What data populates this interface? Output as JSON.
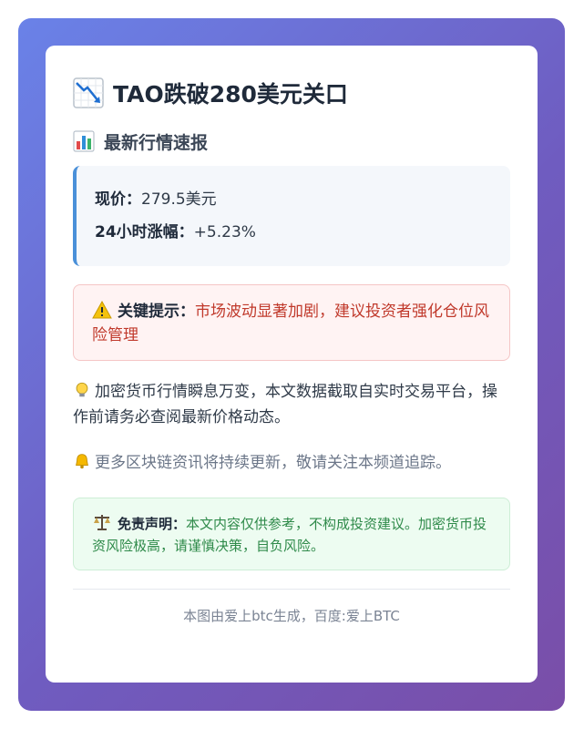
{
  "header": {
    "title_icon": "chart-decreasing-icon",
    "title": "TAO跌破280美元关口"
  },
  "section": {
    "icon": "bar-chart-icon",
    "title": "最新行情速报"
  },
  "quote": {
    "price_label": "现价：",
    "price_value": "279.5美元",
    "change_label": "24小时涨幅：",
    "change_value": "+5.23%"
  },
  "warning": {
    "icon": "warning-icon",
    "label": "关键提示：",
    "text": "市场波动显著加剧，建议投资者强化仓位风险管理"
  },
  "notes": {
    "tip_icon": "lightbulb-icon",
    "tip_text": "加密货币行情瞬息万变，本文数据截取自实时交易平台，操作前请务必查阅最新价格动态。",
    "bell_icon": "bell-icon",
    "bell_text": "更多区块链资讯将持续更新，敬请关注本频道追踪。"
  },
  "disclaimer": {
    "icon": "scales-icon",
    "label": "免责声明：",
    "text": "本文内容仅供参考，不构成投资建议。加密货币投资风险极高，请谨慎决策，自负风险。"
  },
  "footer": {
    "text": "本图由爱上btc生成，百度:爱上BTC"
  },
  "colors": {
    "accent_blue": "#4a90d9",
    "warning_red": "#c0392b",
    "success_green": "#2f8a4a"
  }
}
